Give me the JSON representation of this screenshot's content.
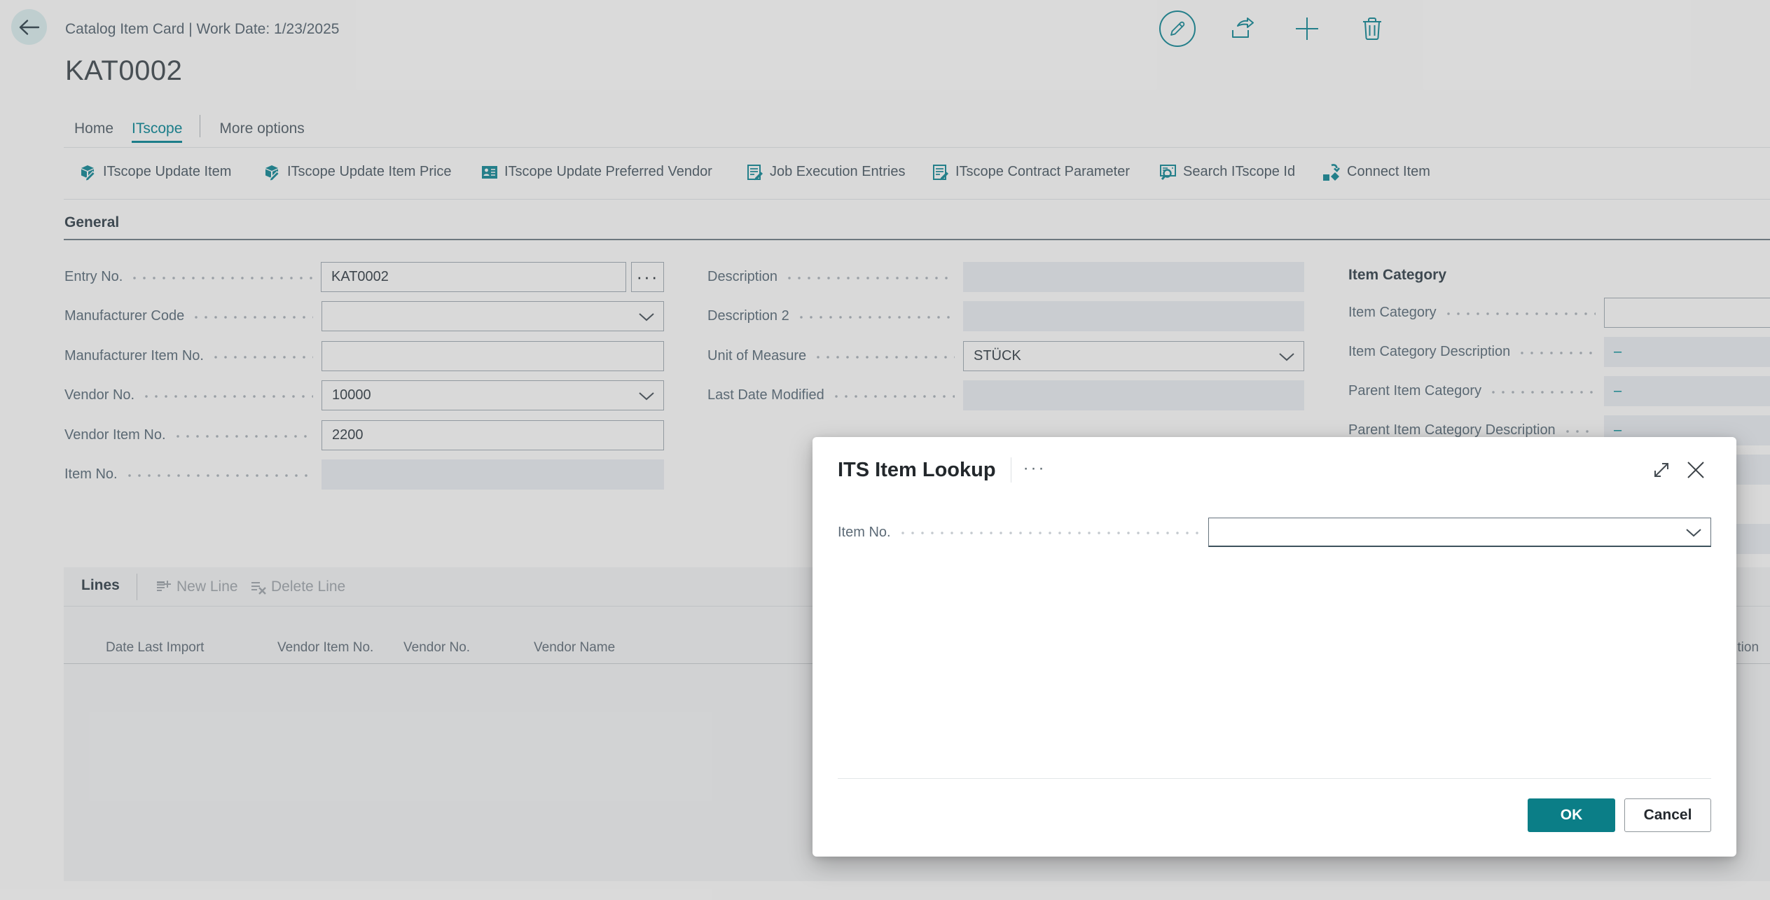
{
  "header": {
    "breadcrumb": "Catalog Item Card | Work Date: 1/23/2025",
    "page_title": "KAT0002",
    "toolbar": {
      "edit_icon": "pencil",
      "share_icon": "share",
      "new_icon": "plus",
      "delete_icon": "trash"
    }
  },
  "tabs": {
    "home": "Home",
    "itscope": "ITscope",
    "more": "More options"
  },
  "actions": {
    "update_item": "ITscope Update Item",
    "update_item_price": "ITscope Update Item Price",
    "update_preferred_vendor": "ITscope Update Preferred Vendor",
    "job_execution_entries": "Job Execution Entries",
    "contract_parameter": "ITscope Contract Parameter",
    "search_itscope_id": "Search ITscope Id",
    "connect_item": "Connect Item"
  },
  "general": {
    "section_title": "General",
    "left_fields": [
      {
        "label": "Entry No.",
        "value": "KAT0002",
        "ellipsis": "···"
      },
      {
        "label": "Manufacturer Code",
        "value": ""
      },
      {
        "label": "Manufacturer Item No.",
        "value": ""
      },
      {
        "label": "Vendor No.",
        "value": "10000"
      },
      {
        "label": "Vendor Item No.",
        "value": "2200"
      },
      {
        "label": "Item No.",
        "value": ""
      }
    ],
    "middle_fields": [
      {
        "label": "Description",
        "value": ""
      },
      {
        "label": "Description 2",
        "value": ""
      },
      {
        "label": "Unit of Measure",
        "value": "STÜCK"
      },
      {
        "label": "Last Date Modified",
        "value": ""
      }
    ],
    "item_category_group": {
      "heading": "Item Category",
      "fields": [
        {
          "label": "Item Category",
          "value": ""
        },
        {
          "label": "Item Category Description",
          "value": "–"
        },
        {
          "label": "Parent Item Category",
          "value": "–"
        },
        {
          "label": "Parent Item Category Description",
          "value": "–"
        }
      ]
    }
  },
  "lines": {
    "title": "Lines",
    "new_line": "New Line",
    "delete_line": "Delete Line",
    "columns": [
      "Date Last Import",
      "Vendor Item No.",
      "Vendor No.",
      "Vendor Name",
      "Description"
    ],
    "rows": []
  },
  "dialog": {
    "title": "ITS Item Lookup",
    "ellipsis": "···",
    "field": {
      "label": "Item No.",
      "value": ""
    },
    "ok": "OK",
    "cancel": "Cancel"
  },
  "colors": {
    "accent_teal": "#1d7e89",
    "primary_button": "#0b7e87",
    "dialog_background": "#ffffff"
  }
}
